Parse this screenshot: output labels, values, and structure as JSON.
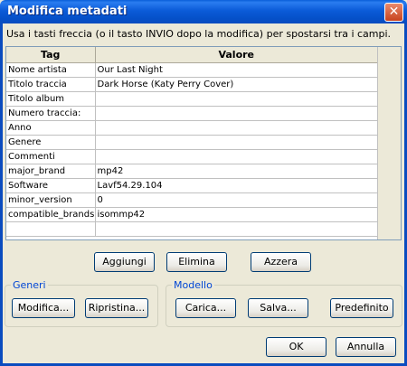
{
  "window": {
    "title": "Modifica metadati",
    "close_symbol": "✕"
  },
  "instruction": "Usa i tasti freccia (o il tasto INVIO dopo la modifica) per spostarsi tra i campi.",
  "table": {
    "headers": [
      "Tag",
      "Valore"
    ],
    "rows": [
      {
        "tag": "Nome artista",
        "value": "Our Last Night"
      },
      {
        "tag": "Titolo traccia",
        "value": "Dark Horse (Katy Perry Cover)"
      },
      {
        "tag": "Titolo album",
        "value": ""
      },
      {
        "tag": "Numero traccia:",
        "value": ""
      },
      {
        "tag": "Anno",
        "value": ""
      },
      {
        "tag": "Genere",
        "value": ""
      },
      {
        "tag": "Commenti",
        "value": ""
      },
      {
        "tag": "major_brand",
        "value": "mp42"
      },
      {
        "tag": "Software",
        "value": "Lavf54.29.104"
      },
      {
        "tag": "minor_version",
        "value": "0"
      },
      {
        "tag": "compatible_brands",
        "value": "isommp42"
      },
      {
        "tag": "",
        "value": ""
      }
    ]
  },
  "actions": {
    "add": "Aggiungi",
    "delete": "Elimina",
    "clear": "Azzera"
  },
  "genres_group": {
    "label": "Generi",
    "edit": "Modifica...",
    "restore": "Ripristina..."
  },
  "template_group": {
    "label": "Modello",
    "load": "Carica...",
    "save": "Salva...",
    "default": "Predefinito"
  },
  "dialog": {
    "ok": "OK",
    "cancel": "Annulla"
  }
}
